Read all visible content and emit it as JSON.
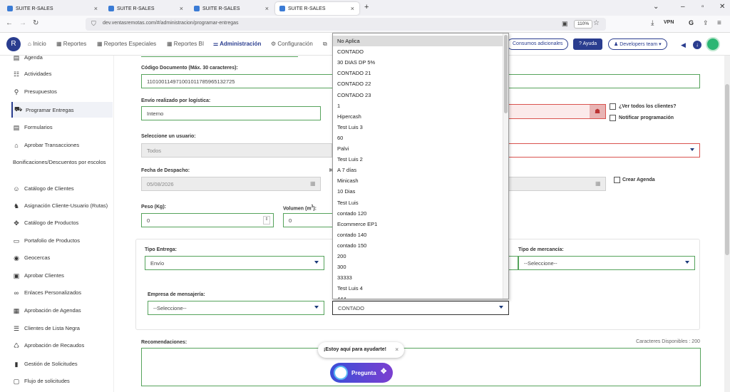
{
  "browser": {
    "tabs": [
      {
        "title": "SUITE R-SALES"
      },
      {
        "title": "SUITE R-SALES"
      },
      {
        "title": "SUITE R-SALES"
      },
      {
        "title": "SUITE R-SALES"
      }
    ],
    "new_tab": "+",
    "url": "dev.ventasremotas.com/#/administracion/programar-entregas",
    "zoom": "110%",
    "vpn": "VPN"
  },
  "nav": {
    "inicio": "Inicio",
    "reportes": "Reportes",
    "reportes_especiales": "Reportes Especiales",
    "reportes_bi": "Reportes BI",
    "administracion": "Administración",
    "configuracion": "Configuración",
    "consumos": "Consumos adicionales",
    "ayuda": "Ayuda",
    "developers": "Developers team"
  },
  "sidebar": {
    "items": [
      {
        "label": "Agenda",
        "icon": "calendar-icon"
      },
      {
        "label": "Actividades",
        "icon": "activities-icon"
      },
      {
        "label": "Presupuestos",
        "icon": "budget-icon"
      },
      {
        "label": "Programar Entregas",
        "icon": "truck-icon"
      },
      {
        "label": "Formularios",
        "icon": "form-icon"
      },
      {
        "label": "Aprobar Transacciones",
        "icon": "bank-icon"
      },
      {
        "label": "Bonificaciones/Descuentos por escolos",
        "icon": "gift-icon"
      },
      {
        "label": "Catálogo de Clientes",
        "icon": "clients-icon"
      },
      {
        "label": "Asignación Cliente-Usuario (Rutas)",
        "icon": "route-icon"
      },
      {
        "label": "Catálogo de Productos",
        "icon": "products-icon"
      },
      {
        "label": "Portafolio de Productos",
        "icon": "folder-icon"
      },
      {
        "label": "Geocercas",
        "icon": "geofence-icon"
      },
      {
        "label": "Aprobar Clientes",
        "icon": "approve-icon"
      },
      {
        "label": "Enlaces Personalizados",
        "icon": "link-icon"
      },
      {
        "label": "Aprobación de Agendas",
        "icon": "calendar-check-icon"
      },
      {
        "label": "Clientes de Lista Negra",
        "icon": "list-icon"
      },
      {
        "label": "Aprobación de Recaudos",
        "icon": "collect-icon"
      },
      {
        "label": "Gestión de Solicitudes",
        "icon": "file-icon"
      },
      {
        "label": "Flujo de solicitudes",
        "icon": "flow-icon"
      }
    ]
  },
  "form": {
    "codigo_label": "Código Documento (Máx. 30 caracteres):",
    "codigo_value": "110100114971001011785965132725",
    "envio_label": "Envío realizado por logística:",
    "envio_value": "Interno",
    "ver_todos": "¿Ver todos los clientes?",
    "notificar": "Notificar programación",
    "usuario_label": "Seleccione un usuario:",
    "usuario_value": "Todos",
    "fecha_label": "Fecha de Despacho:",
    "fecha_value": "05/08/2026",
    "hora_partial": "H",
    "crear_agenda": "Crear Agenda",
    "peso_label": "Peso (Kg):",
    "peso_value": "0",
    "volumen_label": "Volumen (m",
    "volumen_sup": "3",
    "volumen_suffix": "):",
    "volumen_value": "0",
    "tipo_entrega_label": "Tipo Entrega:",
    "tipo_entrega_value": "Envío",
    "tipo_mercancia_label": "Tipo de mercancía:",
    "tipo_mercancia_value": "--Seleccione--",
    "empresa_label": "Empresa de mensajería:",
    "empresa_value": "--Seleccione--",
    "condicion_value": "CONTADO",
    "recomendaciones_label": "Recomendaciones:",
    "caracteres": "Caracteres Disponibles : 200"
  },
  "dropdown": {
    "options": [
      "No Aplica",
      "CONTADO",
      "30 DIAS DP 5%",
      "CONTADO 21",
      "CONTADO 22",
      "CONTADO 23",
      "1",
      "Hipercash",
      "Test Luis 3",
      "60",
      "Palvi",
      "Test Luis 2",
      "A 7 días",
      "Minicash",
      "10 Dias",
      "Test Luis",
      "contado 120",
      "Ecommerce EP1",
      "contado 140",
      "contado 150",
      "200",
      "300",
      "33333",
      "Test Luis 4",
      "444"
    ]
  },
  "bot": {
    "bubble": "¡Estoy aquí para ayudarte!",
    "close": "×",
    "button": "Pregunta"
  },
  "colors": {
    "brand": "#2a3d8f",
    "valid": "#56a35c",
    "error": "#d9534f",
    "bot": "#5b44d6"
  }
}
